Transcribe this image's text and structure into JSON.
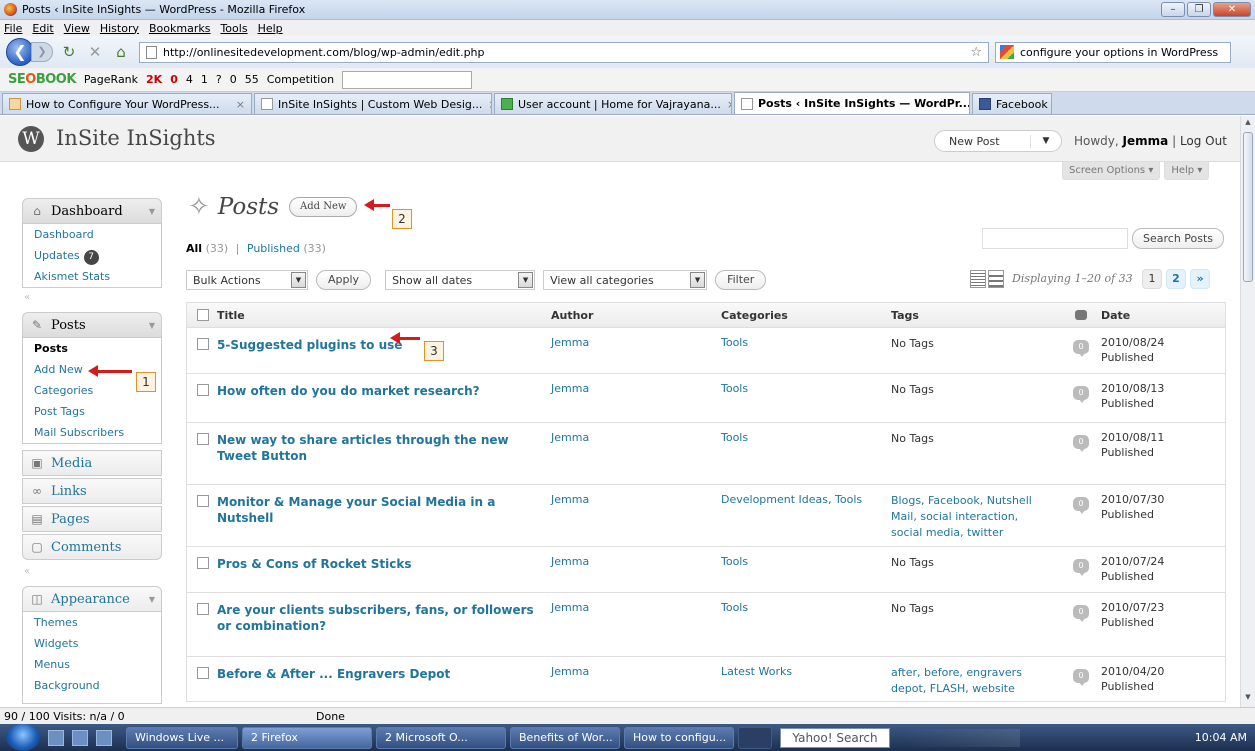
{
  "window": {
    "title": "Posts ‹ InSite InSights — WordPress - Mozilla Firefox",
    "buttons": [
      "–",
      "❐",
      "✕"
    ]
  },
  "menubar": [
    "File",
    "Edit",
    "View",
    "History",
    "Bookmarks",
    "Tools",
    "Help"
  ],
  "nav": {
    "url": "http://onlinesitedevelopment.com/blog/wp-admin/edit.php",
    "search": "configure your options in WordPress"
  },
  "seobar": {
    "logo_a": "SE",
    "logo_b": "O",
    "logo_c": "BOOK",
    "pagerank": "PageRank",
    "items": [
      "2K",
      "0",
      "4",
      "1",
      "?",
      "0",
      "55"
    ],
    "competition": "Competition"
  },
  "tabs": [
    {
      "label": "How to Configure Your WordPress...",
      "icon": "edge"
    },
    {
      "label": "InSite InSights | Custom Web Desig...",
      "icon": "page"
    },
    {
      "label": "User account | Home for Vajrayana...",
      "icon": "check"
    },
    {
      "label": "Posts ‹ InSite InSights — WordPr...",
      "icon": "page",
      "active": true
    },
    {
      "label": "Facebook",
      "icon": "fb"
    }
  ],
  "wp": {
    "site_title": "InSite InSights",
    "fav_action": "New Post",
    "howdy": "Howdy,",
    "user": "Jemma",
    "logout": "Log Out",
    "screen_options": "Screen Options ▾",
    "help": "Help ▾"
  },
  "sidebar": {
    "dashboard": "Dashboard",
    "dashboard_items": [
      "Dashboard",
      "Updates",
      "Akismet Stats"
    ],
    "updates_count": "7",
    "posts": "Posts",
    "posts_items": [
      "Posts",
      "Add New",
      "Categories",
      "Post Tags",
      "Mail Subscribers"
    ],
    "media": "Media",
    "links": "Links",
    "pages": "Pages",
    "comments": "Comments",
    "appearance": "Appearance",
    "appearance_items": [
      "Themes",
      "Widgets",
      "Menus",
      "Background"
    ]
  },
  "main": {
    "title": "Posts",
    "add_new": "Add New",
    "filter_all": "All",
    "filter_all_count": "(33)",
    "filter_published": "Published",
    "filter_published_count": "(33)",
    "search_button": "Search Posts",
    "bulk_actions": "Bulk Actions",
    "apply": "Apply",
    "dates": "Show all dates",
    "categories": "View all categories",
    "filter": "Filter",
    "displaying": "Displaying 1–20 of 33",
    "pages": [
      "1",
      "2",
      "»"
    ]
  },
  "callouts": [
    "1",
    "2",
    "3"
  ],
  "table": {
    "headers": [
      "Title",
      "Author",
      "Categories",
      "Tags",
      "Date"
    ],
    "rows": [
      {
        "title": "5-Suggested plugins to use",
        "author": "Jemma",
        "categories": "Tools",
        "tags": "No Tags",
        "date": "2010/08/24",
        "status": "Published",
        "comments": "0"
      },
      {
        "title": "How often do you do market research?",
        "author": "Jemma",
        "categories": "Tools",
        "tags": "No Tags",
        "date": "2010/08/13",
        "status": "Published",
        "comments": "0"
      },
      {
        "title": "New way to share articles through the new Tweet Button",
        "author": "Jemma",
        "categories": "Tools",
        "tags": "No Tags",
        "date": "2010/08/11",
        "status": "Published",
        "comments": "0"
      },
      {
        "title": "Monitor & Manage your Social Media in a Nutshell",
        "author": "Jemma",
        "categories": "Development Ideas, Tools",
        "tags": "Blogs, Facebook, Nutshell Mail, social interaction, social media, twitter",
        "date": "2010/07/30",
        "status": "Published",
        "comments": "0"
      },
      {
        "title": "Pros & Cons of Rocket Sticks",
        "author": "Jemma",
        "categories": "Tools",
        "tags": "No Tags",
        "date": "2010/07/24",
        "status": "Published",
        "comments": "0"
      },
      {
        "title": "Are your clients subscribers, fans, or followers or combination?",
        "author": "Jemma",
        "categories": "Tools",
        "tags": "No Tags",
        "date": "2010/07/23",
        "status": "Published",
        "comments": "0"
      },
      {
        "title": "Before & After ... Engravers Depot",
        "author": "Jemma",
        "categories": "Latest Works",
        "tags": "after, before, engravers depot, FLASH, website",
        "date": "2010/04/20",
        "status": "Published",
        "comments": "0"
      }
    ]
  },
  "status": {
    "left": "90 / 100  Visits: n/a / 0",
    "done": "Done"
  },
  "taskbar": {
    "items": [
      "Windows Live ...",
      "2 Firefox",
      "2 Microsoft O...",
      "Benefits of Wor...",
      "How to configu..."
    ],
    "yahoo": "Yahoo! Search",
    "clock": "10:04 AM"
  }
}
